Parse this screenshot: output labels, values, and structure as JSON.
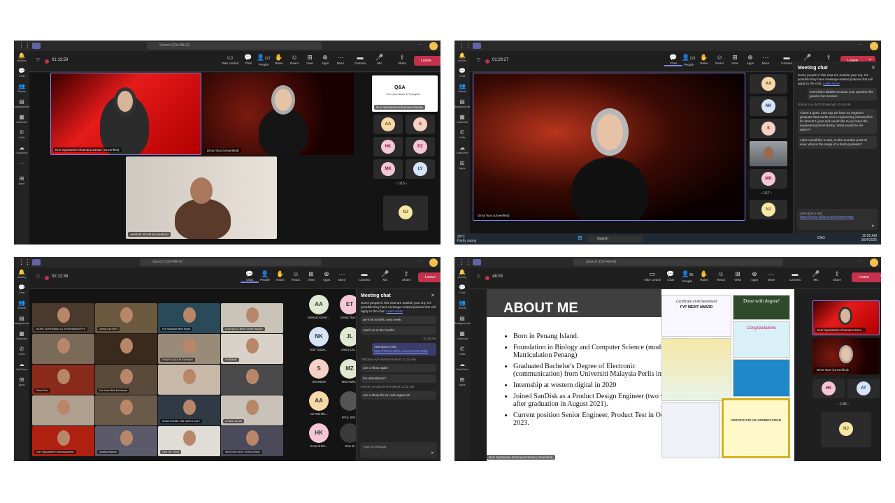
{
  "common": {
    "search_placeholder": "Search (Ctrl+Alt+E)",
    "rail": [
      "Activity",
      "Chat",
      "Teams",
      "Assignments",
      "Calendar",
      "Calls",
      "OneDrive",
      "Apps"
    ],
    "more_dots": "···",
    "toolbar": {
      "take_control": "Take control",
      "chat": "Chat",
      "people": "People",
      "raise": "Raise",
      "react": "React",
      "view": "View",
      "apps": "Apps",
      "more": "More",
      "camera": "Camera",
      "mic": "Mic",
      "share": "Share",
      "leave": "Leave"
    }
  },
  "p1": {
    "time": "01:13:59",
    "people_count": "127",
    "names": [
      "Nurr Syazwanie Khamaruzzaman (Unverified)",
      "Dima Tsun (Unverified)",
      "AHMAD ADAM (Unverified)",
      "Nurr Syazwanie Khamaruzzaman"
    ],
    "slide_title": "Q&A",
    "slide_sub": "Your Questions & Thoughts",
    "avatars": [
      "AA",
      "S",
      "HK",
      "PZ",
      "MK",
      "LY",
      "NJ"
    ],
    "pager": "1/15"
  },
  "p2": {
    "time": "01:29:27",
    "people_count": "121",
    "presenter": "Dima Tsun (Unverified)",
    "avatars": [
      "AA",
      "NK",
      "S",
      "MK",
      "NJ"
    ],
    "pager": "1/17",
    "chat": {
      "title": "Meeting chat",
      "notice": "Some people in this chat are outside your org. It's possible they have message-related policies that will apply to the chat.",
      "learn": "Learn more",
      "prev": "even fatin nabilah because your question fits good in her session",
      "sender": "Jimmy Lau (MY) (External)  10:46 AM",
      "msg1": "I have a ques. Lets say we have an engineer graduate that works not in engineering industry/firm for almost 1 year and would like to join back the engineering firm/industry. What would be the advice?",
      "msg2": "I also would like to ask, on the recruiter point of view, what is the range of a fresh graduate?",
      "attendance_label": "Attendance link:",
      "attendance_url": "https://forms.office.com/r/7luwRYvMfp"
    },
    "taskbar": {
      "weather": "29°C",
      "weather_sub": "Partly sunny",
      "search": "Search",
      "lang": "ENG",
      "time": "10:50 AM",
      "date": "30/4/2025"
    }
  },
  "p3": {
    "time": "02:12:38",
    "grid_names": [
      "MOHD NORHAMAN A L KRISHNAMURTHI",
      "Jimmy Lau (MY)",
      "Nur Syahidah Binti Ismail",
      "IZZA NELLY BINTI MOHD NASIR",
      "",
      "",
      "KHAIR SAUDUR RAHMAN",
      "SHARMIN",
      "Dima Tsun",
      "Nur Iman Binti Muhamad",
      "",
      "",
      "",
      "",
      "ADAM DANIEL BIN SAIFUL AZLY",
      "AHMAD ADAM",
      "Nurr Syazwanie Khamaruzzaman",
      "Syafiqa Saleem",
      "FAN JIE TONG",
      "MARDIAH BINTI MOHALIWAN"
    ],
    "side": [
      {
        "i": "AA",
        "n": "AHMAD ADAM ..."
      },
      {
        "i": "ET",
        "n": "Divina Tsun ..."
      },
      {
        "i": "NK",
        "n": "Nurr Syazw..."
      },
      {
        "i": "JL",
        "n": "Jimmy Lau ..."
      },
      {
        "i": "S",
        "n": "SHARMIN"
      },
      {
        "i": "MZ",
        "n": "MUHAMM..."
      },
      {
        "i": "AA",
        "n": "ALIYEB MU..."
      },
      {
        "i": "",
        "n": "PAUL SIM..."
      },
      {
        "i": "HK",
        "n": "Hezerul Bin..."
      },
      {
        "i": "···",
        "n": "View all"
      }
    ],
    "chat": {
      "title": "Meeting chat",
      "notice": "Some people in this chat are outside your org. It's possible they have message-related policies that will apply to the chat.",
      "learn": "Learn more",
      "m1": "we'll be in MMU next week",
      "m2": "catch us at the booth!!",
      "t1": "11:32 AM",
      "att_label": "Attendance link:",
      "att_url": "https://forms.office.com/r/7luwRYvMfp",
      "s2": "TRESHA A/P MANIVANNAN  11:33 AM",
      "m3": "can u show again",
      "m4": "the attendance?",
      "s3": "KHAIR SAUDUR RAHMAN  11:33 AM",
      "m5": "can u show the qr code again plz",
      "input": "Type a message"
    }
  },
  "p4": {
    "time": "48:03",
    "people_count": "95",
    "slide": {
      "title": "ABOUT ME",
      "bullets": [
        "Born in Penang Island.",
        "Foundation in Biology and Computer Science (module III, Matriculation Penang)",
        "Graduated Bachelor's Degree of Electronic (communication) from Universiti Malaysia Perlis in 2021.",
        "Internship at western digital in 2020",
        "Joined SanDisk as a Product Design Engineer (two weeks after graduation in August 2021).",
        "Current position Senior Engineer, Product Test in October 2023."
      ],
      "cert1": "Certificate of Achievement",
      "cert1b": "FYP MERIT AWARD",
      "done": "Done with degree!",
      "congrats": "Congratulations",
      "appreciation": "CERTIFICATE OF APPRECIATION"
    },
    "presenter": "Nurr Syazwanie Khamaruzzaman (Unverified)",
    "names": [
      "Nurr Syazwanie Khamaruzzam...",
      "Dima Tsun (Unverified)"
    ],
    "avatars": [
      "HK",
      "AT",
      "NJ"
    ],
    "pager": "1/46"
  }
}
